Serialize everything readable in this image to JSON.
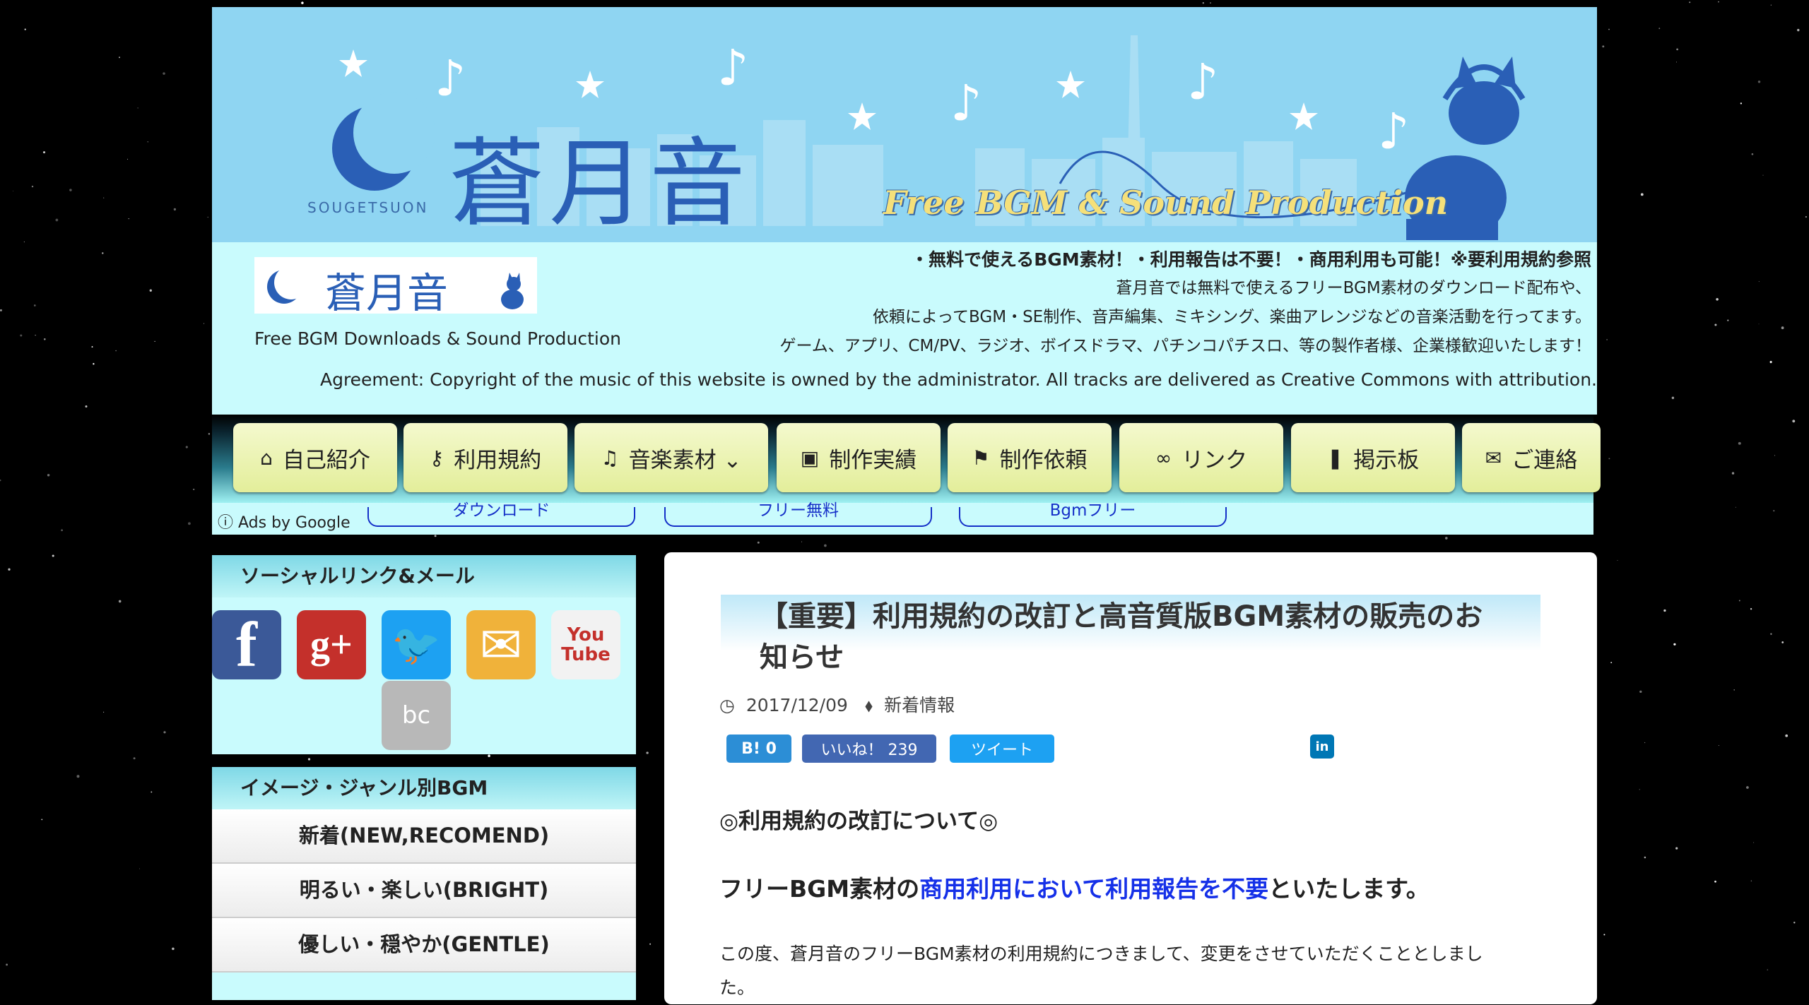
{
  "banner": {
    "title": "蒼月音",
    "subtitle": "Free BGM & Sound Production",
    "logo_text": "SOUGETSUON"
  },
  "info": {
    "logo_title": "蒼月音",
    "tagline": "Free BGM Downloads & Sound Production",
    "lines": [
      "・無料で使えるBGM素材！・利用報告は不要！・商用利用も可能！※要利用規約参照",
      "蒼月音では無料で使えるフリーBGM素材のダウンロード配布や、",
      "依頼によってBGM・SE制作、音声編集、ミキシング、楽曲アレンジなどの音楽活動を行ってます。",
      "ゲーム、アプリ、CM/PV、ラジオ、ボイスドラマ、パチンコパチスロ、等の製作者様、企業様歓迎いたします！"
    ],
    "agreement": "Agreement: Copyright of the music of this website is owned by the administrator. All tracks are delivered as Creative Commons with attribution."
  },
  "nav": {
    "items": [
      {
        "icon": "⌂",
        "label": "自己紹介"
      },
      {
        "icon": "⚷",
        "label": "利用規約"
      },
      {
        "icon": "♫",
        "label": "音楽素材 ⌄"
      },
      {
        "icon": "▣",
        "label": "制作実績"
      },
      {
        "icon": "⚑",
        "label": "制作依頼"
      },
      {
        "icon": "∞",
        "label": "リンク"
      },
      {
        "icon": "❚",
        "label": "掲示板"
      },
      {
        "icon": "✉",
        "label": "ご連絡"
      }
    ]
  },
  "ads": {
    "label": "ⓘ Ads by Google",
    "links": [
      "ダウンロード",
      "フリー無料",
      "Bgmフリー"
    ]
  },
  "sidebar": {
    "social_heading": "ソーシャルリンク&メール",
    "social_icons": [
      {
        "name": "facebook",
        "glyph": "f",
        "color": "#3b5998"
      },
      {
        "name": "google-plus",
        "glyph": "g+",
        "color": "#c4302b"
      },
      {
        "name": "twitter",
        "glyph": "🐦",
        "color": "#1da1f2"
      },
      {
        "name": "mail",
        "glyph": "✉",
        "color": "#f0b23a"
      },
      {
        "name": "youtube",
        "glyph": "You Tube",
        "color": "#f2f2f2"
      },
      {
        "name": "bandcamp",
        "glyph": "bc",
        "color": "#b8b8b8"
      }
    ],
    "genre_heading": "イメージ・ジャンル別BGM",
    "genres": [
      "新着(NEW,RECOMEND)",
      "明るい・楽しい(BRIGHT)",
      "優しい・穏やか(GENTLE)"
    ]
  },
  "post": {
    "title": "【重要】利用規約の改訂と高音質版BGM素材の販売のお知らせ",
    "date": "2017/12/09",
    "category": "新着情報",
    "share": {
      "hatena": "B! 0",
      "like": "いいね！ 239",
      "tweet": "ツイート",
      "linkedin": "in"
    },
    "section_heading": "◎利用規約の改訂について◎",
    "headline_pre": "フリーBGM素材の",
    "headline_link": "商用利用において利用報告を不要",
    "headline_post": "といたします。",
    "body": "この度、蒼月音のフリーBGM素材の利用規約につきまして、変更をさせていただくこととしました。"
  }
}
